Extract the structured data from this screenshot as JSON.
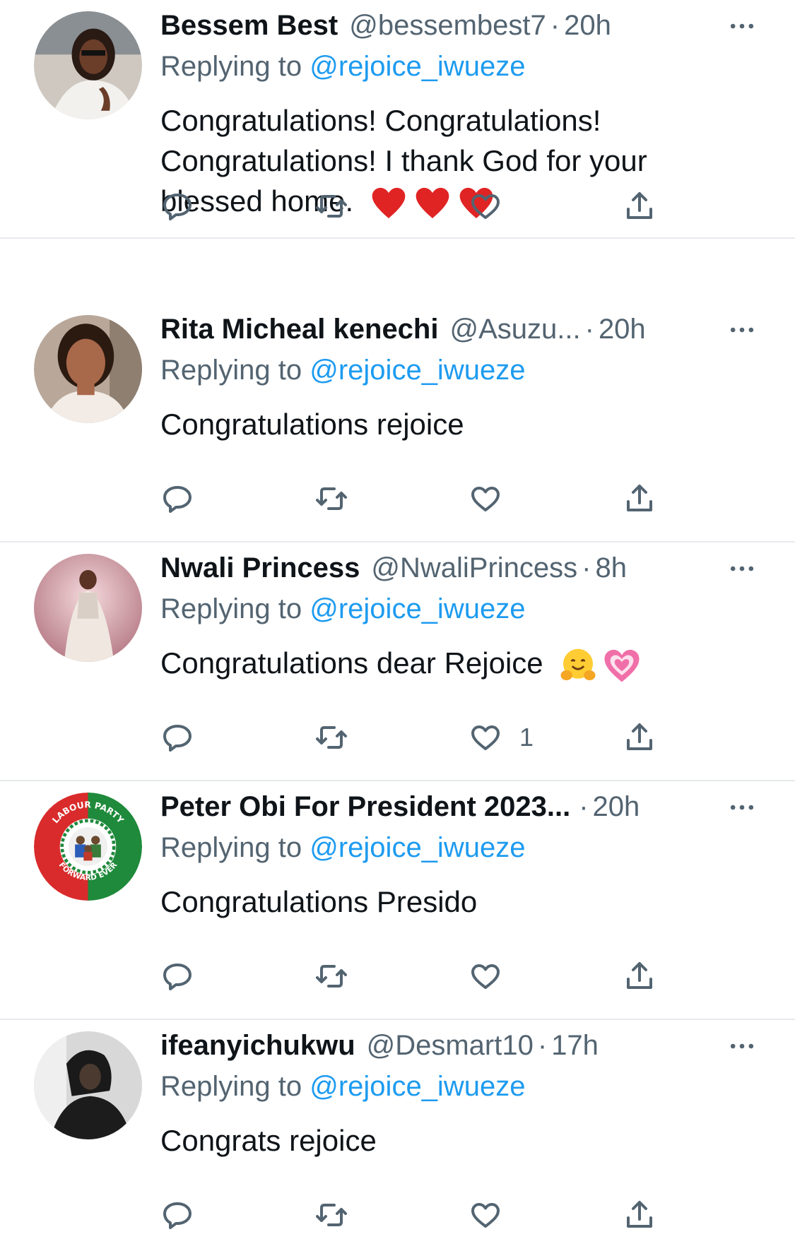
{
  "tweets": [
    {
      "name": "Bessem Best",
      "handle": "@bessembest7",
      "time": "20h",
      "replying_prefix": "Replying to",
      "replying_handle": "@rejoice_iwueze",
      "text": "Congratulations! Congratulations! Congratulations! I thank God for your blessed home.",
      "emojis": [
        "red-heart",
        "red-heart",
        "red-heart"
      ],
      "likes": ""
    },
    {
      "name": "Rita Micheal kenechi",
      "handle": "@Asuzu...",
      "time": "20h",
      "replying_prefix": "Replying to",
      "replying_handle": "@rejoice_iwueze",
      "text": "Congratulations rejoice",
      "emojis": [],
      "likes": ""
    },
    {
      "name": "Nwali Princess",
      "handle": "@NwaliPrincess",
      "time": "8h",
      "replying_prefix": "Replying to",
      "replying_handle": "@rejoice_iwueze",
      "text": "Congratulations dear Rejoice",
      "emojis": [
        "hugging-face",
        "growing-heart"
      ],
      "likes": "1"
    },
    {
      "name": "Peter Obi For President 2023...",
      "handle": "",
      "time": "20h",
      "replying_prefix": "Replying to",
      "replying_handle": "@rejoice_iwueze",
      "text": "Congratulations Presido",
      "emojis": [],
      "likes": ""
    },
    {
      "name": "ifeanyichukwu",
      "handle": "@Desmart10",
      "time": "17h",
      "replying_prefix": "Replying to",
      "replying_handle": "@rejoice_iwueze",
      "text": "Congrats rejoice",
      "emojis": [],
      "likes": ""
    }
  ],
  "dot_separator": "·",
  "logo_text": {
    "top": "LABOUR PARTY",
    "bottom": "FORWARD EVER"
  },
  "colors": {
    "text_primary": "#0f1419",
    "text_secondary": "#536471",
    "link": "#1d9bf0",
    "divider": "#e7e9ec",
    "labour_red": "#d92b2b",
    "labour_green": "#1f8a3b"
  },
  "icons": {
    "reply": "reply-icon",
    "retweet": "retweet-icon",
    "like": "like-icon",
    "share": "share-icon",
    "more": "more-icon"
  }
}
